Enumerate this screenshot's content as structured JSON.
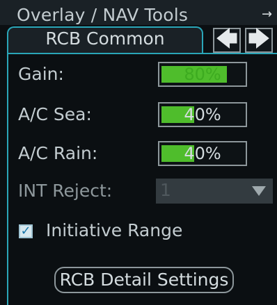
{
  "window": {
    "title": "Overlay / NAV Tools",
    "pin_icon": "→"
  },
  "tabs": {
    "active_label": "RCB Common",
    "prev_icon": "🡄",
    "next_icon": "🡆"
  },
  "controls": {
    "gain": {
      "label": "Gain:",
      "value_text": "80%",
      "level_percent": 80
    },
    "ac_sea": {
      "label": "A/C Sea:",
      "value_text": "40%",
      "level_percent": 40
    },
    "ac_rain": {
      "label": "A/C Rain:",
      "value_text": "40%",
      "level_percent": 40
    },
    "int_reject": {
      "label": "INT Reject:",
      "value": "1"
    }
  },
  "initiative_range": {
    "label": "Initiative Range",
    "checked": true,
    "check_mark": "✓"
  },
  "detail_button": {
    "label": "RCB Detail Settings"
  },
  "colors": {
    "accent": "#2aa6b8",
    "bar_fill": "#4fbd2c",
    "background": "#0b0f12"
  }
}
